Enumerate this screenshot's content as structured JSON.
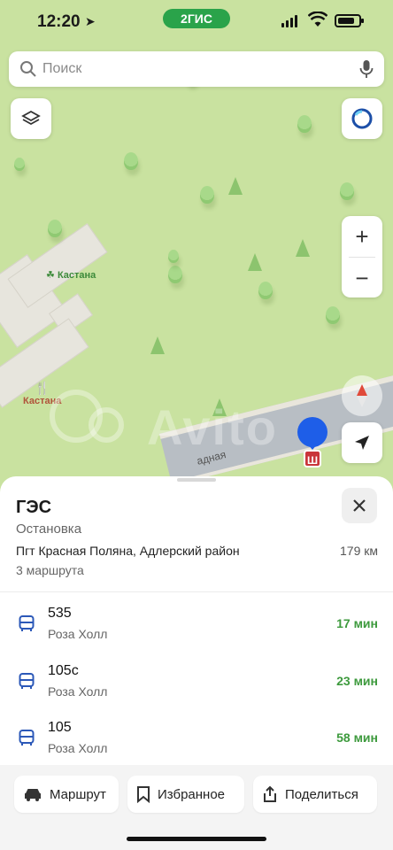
{
  "status_bar": {
    "time": "12:20",
    "brand": "2ГИС"
  },
  "search": {
    "placeholder": "Поиск"
  },
  "map": {
    "poi_1": "Кастана",
    "poi_2": "Кастана",
    "road_label": "адная",
    "watermark": "Avito"
  },
  "zoom": {
    "in_label": "+",
    "out_label": "−"
  },
  "stop": {
    "badge": "Ш",
    "title": "ГЭС",
    "type": "Остановка",
    "address": "Пгт Красная Поляна, Адлерский район",
    "distance": "179 км",
    "routes_count": "3 маршрута"
  },
  "routes": [
    {
      "number": "535",
      "destination": "Роза Холл",
      "eta": "17 мин"
    },
    {
      "number": "105с",
      "destination": "Роза Холл",
      "eta": "23 мин"
    },
    {
      "number": "105",
      "destination": "Роза Холл",
      "eta": "58 мин"
    }
  ],
  "actions": {
    "route_label": "Маршрут",
    "favorite_label": "Избранное",
    "share_label": "Поделиться"
  },
  "colors": {
    "brand_green": "#2aa34a",
    "eta_green": "#3d9a3d",
    "marker_blue": "#1e5ee8",
    "stop_red": "#c9353a"
  }
}
